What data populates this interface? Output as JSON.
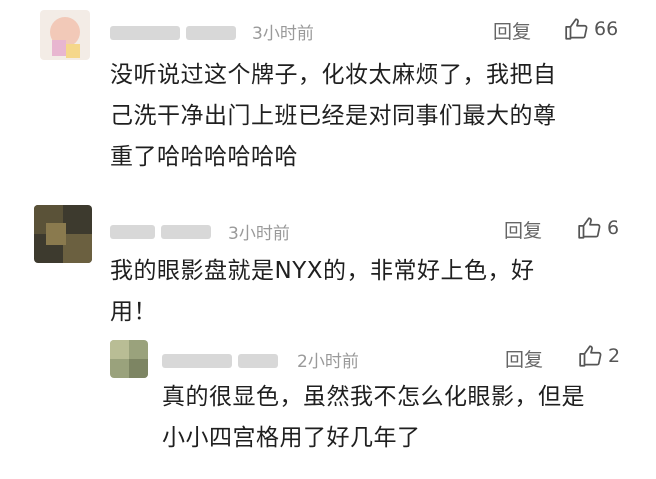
{
  "comments": [
    {
      "time": "3小时前",
      "reply_label": "回复",
      "likes": "66",
      "lines": [
        "没听说过这个牌子，化妆太麻烦了，我把自",
        "己洗干净出门上班已经是对同事们最大的尊",
        "重了哈哈哈哈哈哈"
      ]
    },
    {
      "time": "3小时前",
      "reply_label": "回复",
      "likes": "6",
      "lines": [
        "我的眼影盘就是NYX的，非常好上色，好",
        "用！"
      ]
    },
    {
      "time": "2小时前",
      "reply_label": "回复",
      "likes": "2",
      "lines": [
        "真的很显色，虽然我不怎么化眼影，但是",
        "小小四宫格用了好几年了"
      ]
    }
  ],
  "colors": {
    "text": "#1f1f1f",
    "muted": "#9a9a9a",
    "icon": "#555555"
  }
}
